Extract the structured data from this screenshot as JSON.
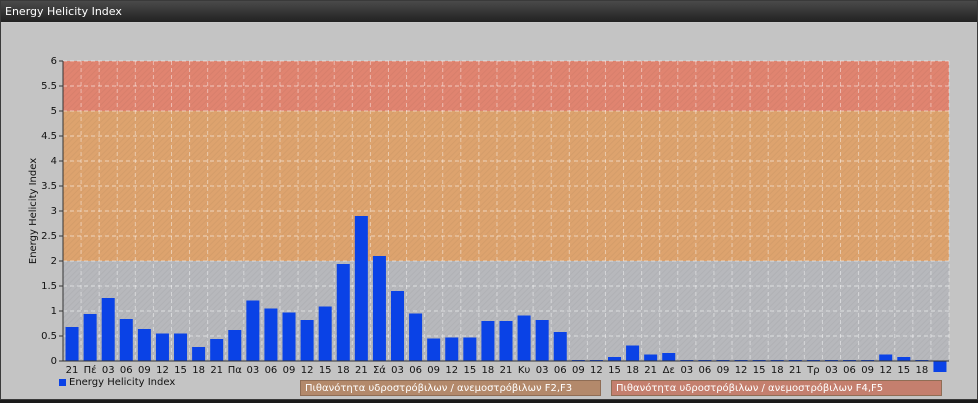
{
  "window": {
    "title": "Energy Helicity Index"
  },
  "colors": {
    "bar": "#0a42e6",
    "zone_low": "#b7b8bc",
    "zone_mid": "#dda36e",
    "zone_high": "#e08470",
    "risk_f2f3": "#b3896b",
    "risk_f4f5": "#c47f6e"
  },
  "legend": {
    "series_label": "Energy Helicity Index",
    "risk_f2f3": "Πιθανότητα υδροστρόβιλων / ανεμοστρόβιλων F2,F3",
    "risk_f4f5": "Πιθανότητα υδροστρόβιλων / ανεμοστρόβιλων F4,F5"
  },
  "chart_data": {
    "type": "bar",
    "title": "",
    "xlabel": "",
    "ylabel": "Energy Helicity Index",
    "ylim": [
      0,
      6
    ],
    "yticks": [
      "0",
      "0.5",
      "1",
      "1.5",
      "2",
      "2.5",
      "3",
      "3.5",
      "4",
      "4.5",
      "5",
      "5.5",
      "6"
    ],
    "grid": true,
    "legend_position": "bottom-left",
    "zones": [
      {
        "from": 0,
        "to": 2,
        "color": "#b7b8bc"
      },
      {
        "from": 2,
        "to": 5,
        "color": "#dda36e"
      },
      {
        "from": 5,
        "to": 6,
        "color": "#e08470"
      }
    ],
    "categories": [
      "21",
      "Πέ",
      "03",
      "06",
      "09",
      "12",
      "15",
      "18",
      "21",
      "Πα",
      "03",
      "06",
      "09",
      "12",
      "15",
      "18",
      "21",
      "Σά",
      "03",
      "06",
      "09",
      "12",
      "15",
      "18",
      "21",
      "Κυ",
      "03",
      "06",
      "09",
      "12",
      "15",
      "18",
      "21",
      "Δε",
      "03",
      "06",
      "09",
      "12",
      "15",
      "18",
      "21",
      "Τρ",
      "03",
      "06",
      "09",
      "12",
      "15",
      "18",
      ""
    ],
    "series": [
      {
        "name": "Energy Helicity Index",
        "values": [
          0.68,
          0.94,
          1.26,
          0.84,
          0.64,
          0.55,
          0.55,
          0.28,
          0.44,
          0.62,
          1.21,
          1.05,
          0.97,
          0.82,
          1.09,
          1.94,
          2.9,
          2.1,
          1.4,
          0.95,
          0.45,
          0.47,
          0.47,
          0.8,
          0.8,
          0.91,
          0.82,
          0.58,
          0.02,
          0.02,
          0.08,
          0.31,
          0.13,
          0.16,
          0.02,
          0.02,
          0.02,
          0.02,
          0.02,
          0.02,
          0.02,
          0.02,
          0.02,
          0.02,
          0.02,
          0.13,
          0.08,
          0.02,
          -0.22
        ]
      }
    ]
  }
}
